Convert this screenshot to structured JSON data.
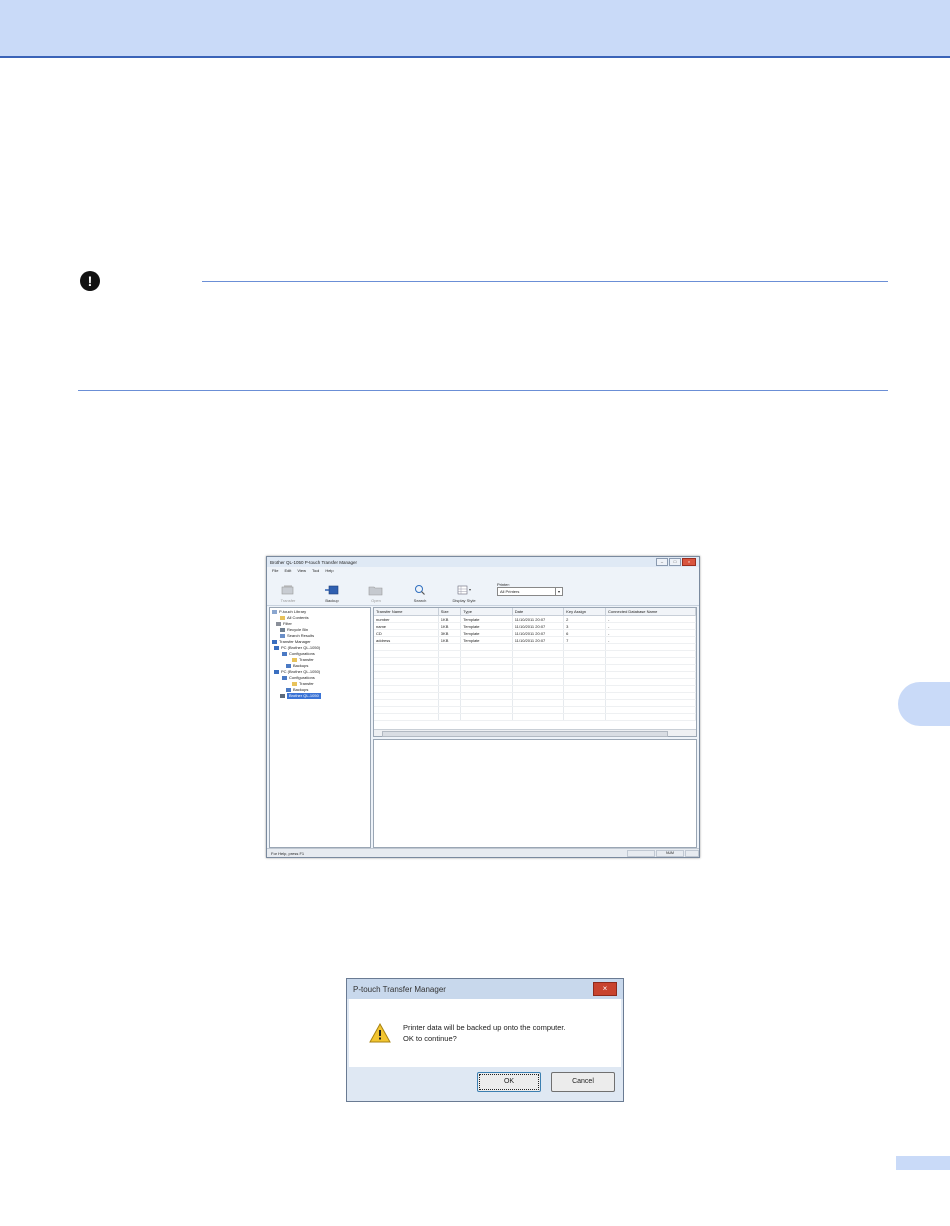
{
  "colors": {
    "accent": "#c9daf8",
    "rule": "#6b8fd6",
    "selection": "#3b74d6"
  },
  "note": {
    "icon": "!"
  },
  "window": {
    "title": "Brother QL-1050 P-touch Transfer Manager",
    "controls": {
      "minimize": "–",
      "maximize": "□",
      "close": "×"
    },
    "menu": [
      "File",
      "Edit",
      "View",
      "Tool",
      "Help"
    ],
    "toolbar": {
      "transfer": "Transfer",
      "backup": "Backup",
      "open": "Open",
      "search": "Search",
      "display_style": "Display Style"
    },
    "printer": {
      "label": "Printer:",
      "value": "All Printers"
    },
    "tree": [
      "P-touch Library",
      "All Contents",
      "Filter",
      "Recycle Bin",
      "Search Results",
      "Transfer Manager",
      "PC (Brother QL-1050)",
      "Configurations",
      "Transfer",
      "Backups",
      "PC (Brother QL-1050)",
      "Configurations",
      "Transfer",
      "Backups",
      "Brother QL-1050"
    ],
    "columns": [
      "Transfer Name",
      "Size",
      "Type",
      "Date",
      "Key Assign",
      "Connected Database Name"
    ],
    "rows": [
      [
        "number",
        "1KB",
        "Template",
        "11/10/2011 20:07",
        "2",
        "-"
      ],
      [
        "name",
        "1KB",
        "Template",
        "11/10/2011 20:07",
        "3",
        "-"
      ],
      [
        "CD",
        "3KB",
        "Template",
        "11/10/2011 20:07",
        "6",
        "-"
      ],
      [
        "address",
        "1KB",
        "Template",
        "11/10/2011 20:07",
        "7",
        "-"
      ]
    ],
    "status": {
      "help": "For Help, press F1",
      "indicator": "NUM"
    }
  },
  "dialog": {
    "title": "P-touch Transfer Manager",
    "close": "×",
    "message_line1": "Printer data will be backed up onto the computer.",
    "message_line2": "OK to continue?",
    "ok": "OK",
    "cancel": "Cancel"
  }
}
